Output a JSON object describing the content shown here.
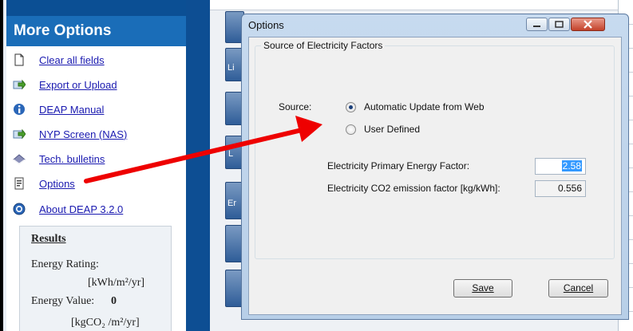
{
  "sidebar": {
    "title": "More Options",
    "items": [
      {
        "label": "Clear all fields",
        "icon": "blank-page-icon"
      },
      {
        "label": "Export or Upload",
        "icon": "export-arrow-icon"
      },
      {
        "label": "DEAP Manual",
        "icon": "info-icon"
      },
      {
        "label": "NYP Screen (NAS)",
        "icon": "export-arrow-icon"
      },
      {
        "label": "Tech. bulletins",
        "icon": "book-icon"
      },
      {
        "label": "Options",
        "icon": "options-page-icon"
      },
      {
        "label": "About DEAP 3.2.0",
        "icon": "help-circle-icon"
      }
    ],
    "results": {
      "heading": "Results",
      "energy_rating_label": "Energy Rating:",
      "energy_rating_unit": "[kWh/m²/yr]",
      "energy_value_label": "Energy Value:",
      "energy_value": "0",
      "co2_unit": "[kgCO₂ /m²/yr]"
    }
  },
  "background": {
    "tab_fragments": [
      "Li",
      "L",
      "Er"
    ]
  },
  "dialog": {
    "title": "Options",
    "group_title": "Source of Electricity Factors",
    "source_label": "Source:",
    "options": [
      {
        "label": "Automatic Update from Web",
        "selected": true
      },
      {
        "label": "User Defined",
        "selected": false
      }
    ],
    "primary_factor_label": "Electricity Primary Energy Factor:",
    "primary_factor_value": "2.58",
    "co2_factor_label": "Electricity CO2 emission factor [kg/kWh]:",
    "co2_factor_value": "0.556",
    "save_label": "Save",
    "cancel_label": "Cancel"
  },
  "colors": {
    "sidebar_header": "#1a6db8",
    "sidebar_topbar": "#0b4f94",
    "link": "#1a1ab0",
    "annotation_arrow": "#ee0000"
  }
}
